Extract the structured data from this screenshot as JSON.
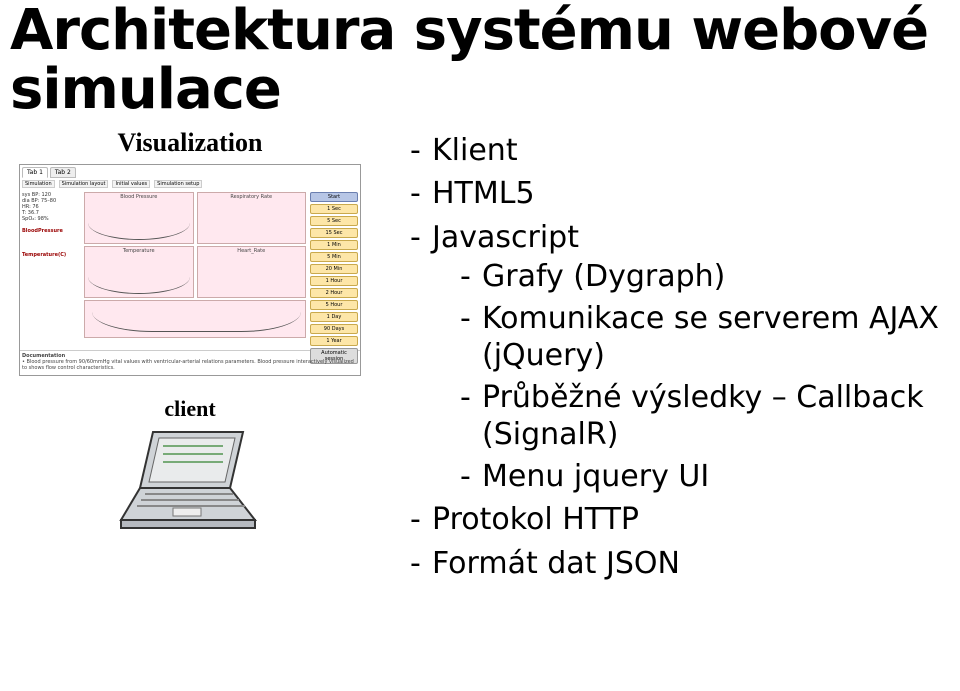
{
  "title": "Architektura systému webové simulace",
  "left": {
    "viz_label": "Visualization",
    "client_label": "client",
    "dashboard": {
      "tabs": {
        "t1": "Tab 1",
        "t2": "Tab 2"
      },
      "menu": {
        "m1": "Simulation",
        "m2": "Simulation layout",
        "m3": "Initial values",
        "m4": "Simulation setup"
      },
      "info": {
        "l1": "sys BP: 120",
        "l2": "dia BP: 75–80",
        "l3": "HR: 76",
        "l4": "T: 36.7",
        "l5": "SpO₂: 98%",
        "bp_label": "BloodPressure",
        "temp_label": "Temperature(C)"
      },
      "charts": {
        "bp": "Blood Pressure",
        "rr": "Respiratory Rate",
        "temp": "Temperature",
        "hr": "Heart_Rate"
      },
      "btns": {
        "b_start": "Start",
        "b1": "1 Sec",
        "b2": "5 Sec",
        "b3": "15 Sec",
        "b4": "1 Min",
        "b5": "5 Min",
        "b6": "20 Min",
        "b7": "1 Hour",
        "b8": "2 Hour",
        "b9": "5 Hour",
        "b10": "1 Day",
        "b11": "90 Days",
        "b12": "1 Year",
        "b_auto": "Automatic session"
      },
      "footer_head": "Documentation",
      "footer": "• Blood pressure from 90/60mmHg vital values with ventricular-arterial relations parameters. Blood pressure interactively visualized to shows flow control characteristics."
    }
  },
  "bullets": {
    "klient": "Klient",
    "html5": "HTML5",
    "javascript": "Javascript",
    "grafy": "Grafy (Dygraph)",
    "komunikace": "Komunikace se serverem AJAX (jQuery)",
    "prubez": "Průběžné výsledky – Callback (SignalR)",
    "menu": "Menu jquery UI",
    "protokol": "Protokol HTTP",
    "format": "Formát dat JSON"
  }
}
